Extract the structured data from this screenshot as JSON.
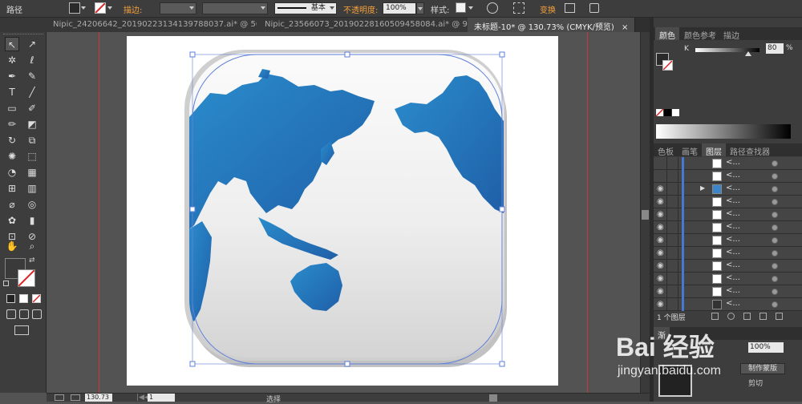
{
  "control_bar": {
    "object_type": "路径",
    "stroke_label": "描边:",
    "stroke_profile": "基本",
    "opacity_label": "不透明度:",
    "opacity_value": "100%",
    "style_label": "样式:",
    "transform_label": "变换"
  },
  "tabs": [
    {
      "label": "Nipic_24206642_20190223134139788037.ai* @ 50...",
      "close": "×",
      "active": false
    },
    {
      "label": "Nipic_23566073_20190228160509458084.ai* @ 98...",
      "close": "×",
      "active": false
    },
    {
      "label": "未标题-10* @ 130.73% (CMYK/预览)",
      "close": "×",
      "active": true
    }
  ],
  "color_panel": {
    "tabs": [
      "颜色",
      "颜色参考",
      "描边"
    ],
    "channel": "K",
    "value": "80",
    "unit": "%"
  },
  "layers_panel": {
    "tabs": [
      "色板",
      "画笔",
      "图层",
      "路径查找器"
    ],
    "rows": [
      {
        "name": "<...",
        "visible": false,
        "expand": ""
      },
      {
        "name": "<...",
        "visible": false,
        "expand": ""
      },
      {
        "name": "<...",
        "visible": true,
        "expand": "▶"
      },
      {
        "name": "<...",
        "visible": true,
        "expand": ""
      },
      {
        "name": "<...",
        "visible": true,
        "expand": ""
      },
      {
        "name": "<...",
        "visible": true,
        "expand": ""
      },
      {
        "name": "<...",
        "visible": true,
        "expand": ""
      },
      {
        "name": "<...",
        "visible": true,
        "expand": ""
      },
      {
        "name": "<...",
        "visible": true,
        "expand": ""
      },
      {
        "name": "<...",
        "visible": true,
        "expand": ""
      },
      {
        "name": "<...",
        "visible": true,
        "expand": ""
      },
      {
        "name": "<...",
        "visible": true,
        "expand": ""
      }
    ],
    "footer": "1 个图层"
  },
  "transparency_panel": {
    "tab": "渐",
    "opacity": "100%",
    "make_mask": "制作蒙版",
    "clip": "剪切"
  },
  "status_bar": {
    "zoom": "130.73",
    "page": "1",
    "tool": "选择"
  },
  "watermark": {
    "brand": "Bai 经验",
    "url": "jingyan.baidu.com"
  },
  "colors": {
    "accent_orange": "#f7a13b",
    "guide_red": "#c83a3a",
    "map_blue": "#1f73b7",
    "selection_blue": "#5f7fd8"
  }
}
